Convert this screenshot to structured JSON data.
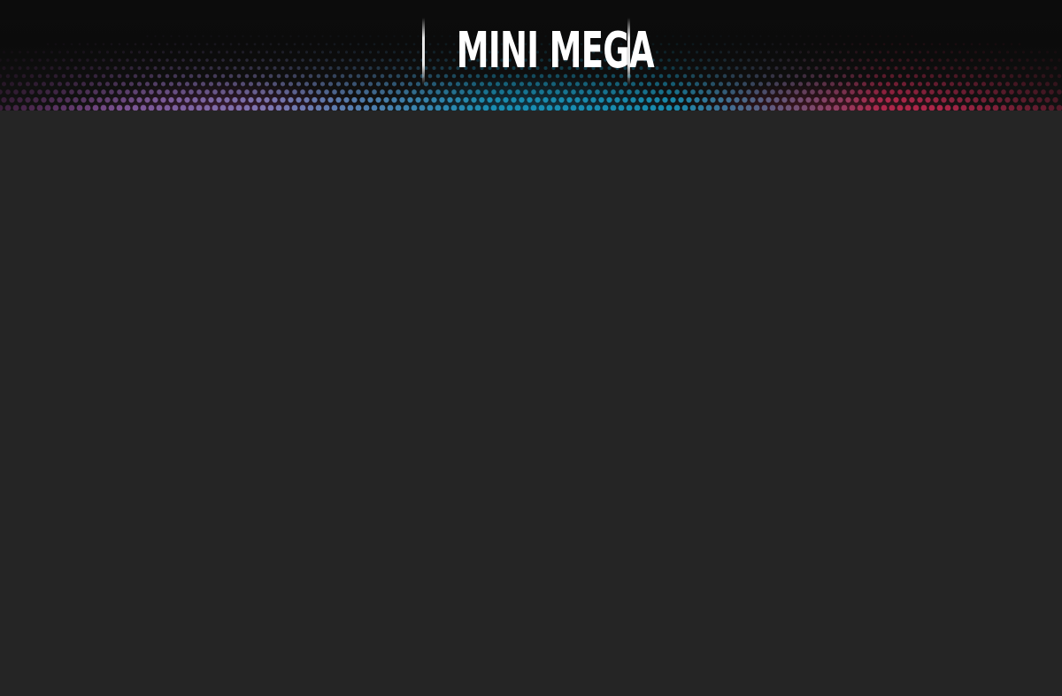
{
  "header": {
    "logo_text": "MINI MEGA"
  },
  "colors": {
    "header_background": "#0b0b0b",
    "page_background": "#252525",
    "dot_purple": "#8a3a8a",
    "dot_lavender": "#8c86c8",
    "dot_cyan": "#1b9ec7",
    "dot_red": "#c42a52",
    "logo_text": "#ffffff"
  }
}
